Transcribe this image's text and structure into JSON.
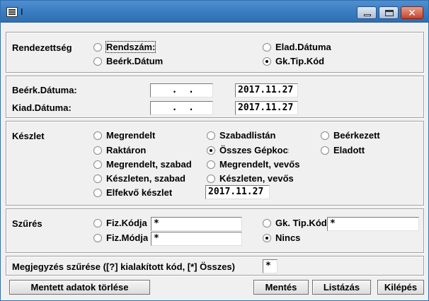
{
  "window": {
    "title": "I"
  },
  "sorting": {
    "label": "Rendezettség",
    "options": [
      {
        "label": "Rendszám:",
        "checked": false
      },
      {
        "label": "Beérk.Dátum",
        "checked": false
      },
      {
        "label": "Elad.Dátuma",
        "checked": false
      },
      {
        "label": "Gk.Tip.Kód",
        "checked": true
      }
    ]
  },
  "dates": {
    "arrival_label": "Beérk.Dátuma:",
    "arrival_from": "  .  .",
    "arrival_to": "2017.11.27",
    "issue_label": "Kiad.Dátuma:",
    "issue_from": "  .  .",
    "issue_to": "2017.11.27"
  },
  "stock": {
    "label": "Készlet",
    "options": [
      {
        "label": "Megrendelt",
        "checked": false
      },
      {
        "label": "Raktáron",
        "checked": false
      },
      {
        "label": "Megrendelt, szabad",
        "checked": false
      },
      {
        "label": "Készleten, szabad",
        "checked": false
      },
      {
        "label": "Elfekvő készlet",
        "checked": false
      },
      {
        "label": "Szabadlistán",
        "checked": false
      },
      {
        "label": "Összes Gépkocsi",
        "checked": true
      },
      {
        "label": "Megrendelt, vevős",
        "checked": false
      },
      {
        "label": "Készleten, vevős",
        "checked": false
      },
      {
        "label": "Beérkezett",
        "checked": false
      },
      {
        "label": "Eladott",
        "checked": false
      }
    ],
    "obsolete_date": "2017.11.27"
  },
  "filter": {
    "label": "Szűrés",
    "fiz_code_label": "Fiz.Kódja",
    "fiz_code_value": "*",
    "fiz_mode_label": "Fiz.Módja",
    "fiz_mode_value": "*",
    "gk_tip_label": "Gk. Tip.Kód",
    "gk_tip_value": "*",
    "none_label": "Nincs",
    "none_checked": true
  },
  "note": {
    "label": "Megjegyzés szűrése ([?] kialakított kód, [*] Összes)",
    "value": "*"
  },
  "buttons": {
    "clear": "Mentett adatok törlése",
    "save": "Mentés",
    "list": "Listázás",
    "exit": "Kilépés"
  }
}
